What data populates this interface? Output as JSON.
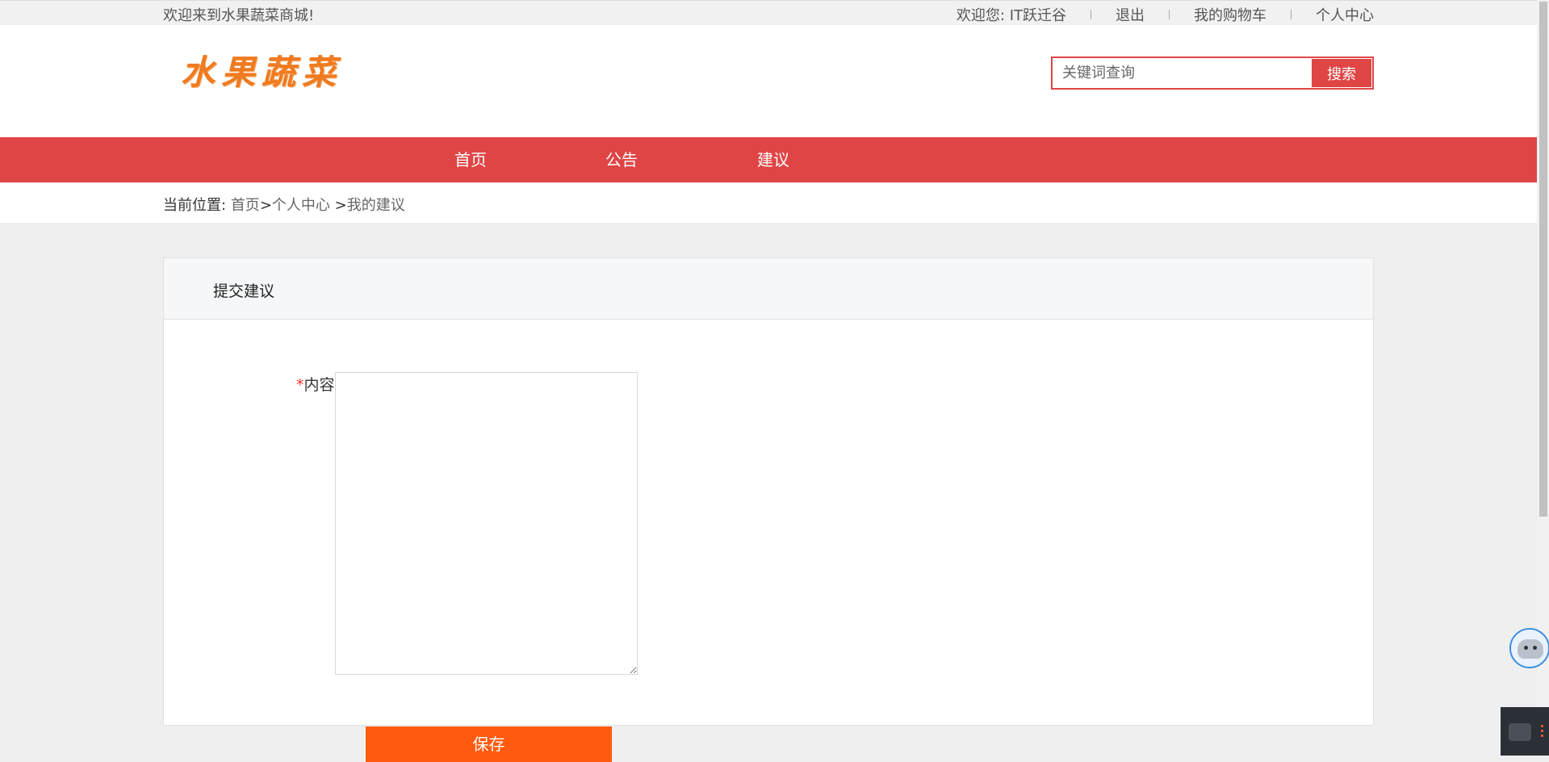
{
  "topbar": {
    "welcome": "欢迎来到水果蔬菜商城!",
    "greeting": "欢迎您: IT跃迁谷",
    "logout": "退出",
    "cart": "我的购物车",
    "profile": "个人中心"
  },
  "header": {
    "logo": "水果蔬菜",
    "search_placeholder": "关键词查询",
    "search_button": "搜索"
  },
  "nav": {
    "items": [
      {
        "label": "首页"
      },
      {
        "label": "公告"
      },
      {
        "label": "建议"
      }
    ]
  },
  "breadcrumb": {
    "prefix": "当前位置:",
    "home": "首页",
    "sep1": ">",
    "center": "个人中心",
    "sep2": " >",
    "current": "我的建议"
  },
  "form": {
    "title": "提交建议",
    "required_mark": "*",
    "content_label": "内容",
    "content_value": "",
    "save_button": "保存"
  },
  "colors": {
    "accent_red": "#df4545",
    "save_orange": "#ff5a0f",
    "logo_orange": "#f07a20"
  }
}
